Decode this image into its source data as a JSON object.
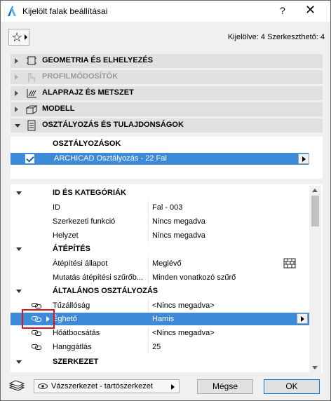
{
  "window": {
    "title": "Kijelölt falak beállításai",
    "help": "?",
    "close": "✕"
  },
  "favorites": {
    "icon": "☆"
  },
  "status": "Kijelölve: 4 Szerkeszthető: 4",
  "sections": [
    {
      "label": "GEOMETRIA ÉS ELHELYEZÉS",
      "icon": "geometry-icon",
      "expanded": false,
      "disabled": false
    },
    {
      "label": "PROFILMÓDOSÍTÓK",
      "icon": "profile-icon",
      "expanded": false,
      "disabled": true
    },
    {
      "label": "ALAPRAJZ ÉS METSZET",
      "icon": "plan-section-icon",
      "expanded": false,
      "disabled": false
    },
    {
      "label": "MODELL",
      "icon": "model-icon",
      "expanded": false,
      "disabled": false
    },
    {
      "label": "OSZTÁLYOZÁS ÉS TULAJDONSÁGOK",
      "icon": "document-icon",
      "expanded": true,
      "disabled": false
    }
  ],
  "classifications": {
    "header": "OSZTÁLYOZÁSOK",
    "row": "ARCHICAD Osztályozás - 22 Fal"
  },
  "properties": {
    "groups": [
      {
        "label": "ID ÉS KATEGÓRIÁK",
        "rows": [
          {
            "name": "ID",
            "value": "Fal - 003"
          },
          {
            "name": "Szerkezeti funkció",
            "value": "Nincs megadva"
          },
          {
            "name": "Helyzet",
            "value": "Nincs megadva"
          }
        ]
      },
      {
        "label": "ÁTÉPÍTÉS",
        "rows": [
          {
            "name": "Átépítési állapot",
            "value": "Meglévő"
          },
          {
            "name": "Mutatás átépítési szűrőb...",
            "value": "Minden vonatkozó szűrő"
          }
        ]
      },
      {
        "label": "ÁLTALÁNOS OSZTÁLYOZÁS",
        "rows": [
          {
            "name": "Tűzállóság",
            "value": "<Nincs megadva>"
          },
          {
            "name": "Éghető",
            "value": "Hamis"
          },
          {
            "name": "Hőátbocsátás",
            "value": "<Nincs megadva>"
          },
          {
            "name": "Hanggátlás",
            "value": "25"
          }
        ]
      },
      {
        "label": "SZERKEZET",
        "rows": []
      }
    ]
  },
  "footer": {
    "dropdown": "Vázszerkezet - tartószerkezet",
    "cancel": "Mégse",
    "ok": "OK"
  },
  "colors": {
    "selection": "#3d8ad8",
    "highlight_box": "#d7161e"
  }
}
